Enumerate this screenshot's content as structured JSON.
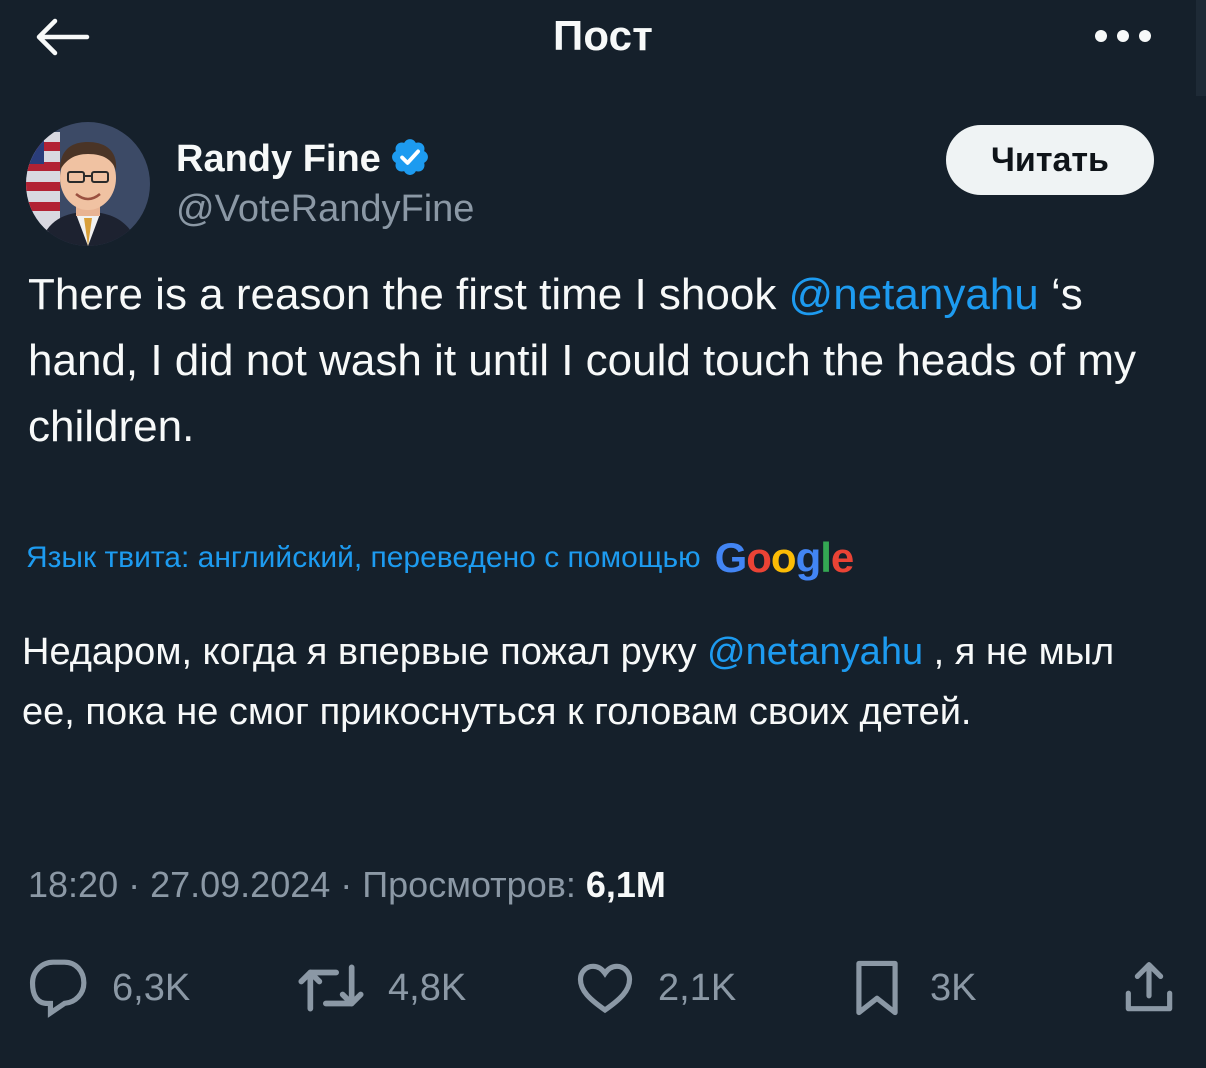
{
  "header": {
    "title": "Пост",
    "back_icon": "arrow-left-icon",
    "more_icon": "more-dots-icon"
  },
  "author": {
    "name": "Randy Fine",
    "handle": "@VoteRandyFine",
    "verified": true,
    "verified_color": "#1d9bf0"
  },
  "follow_button": {
    "label": "Читать"
  },
  "tweet": {
    "text_before": "There is a reason the first time I shook ",
    "mention": "@netanyahu",
    "text_after": " ‘s hand, I did not wash it until I could touch the heads of my children."
  },
  "translation": {
    "note": "Язык твита: английский, переведено с помощью",
    "provider": "Google",
    "text_before": "Недаром, когда я впервые пожал руку ",
    "mention": "@netanyahu",
    "text_after": " , я не мыл ее, пока не смог прикоснуться к головам своих детей."
  },
  "meta": {
    "time": "18:20",
    "separator": " · ",
    "date": "27.09.2024",
    "views_label": "Просмотров:",
    "views_count": "6,1M"
  },
  "actions": {
    "replies": "6,3K",
    "reposts": "4,8K",
    "likes": "2,1K",
    "bookmarks": "3K"
  },
  "colors": {
    "background": "#15202b",
    "accent": "#1d9bf0",
    "secondary_text": "#8b98a5"
  }
}
